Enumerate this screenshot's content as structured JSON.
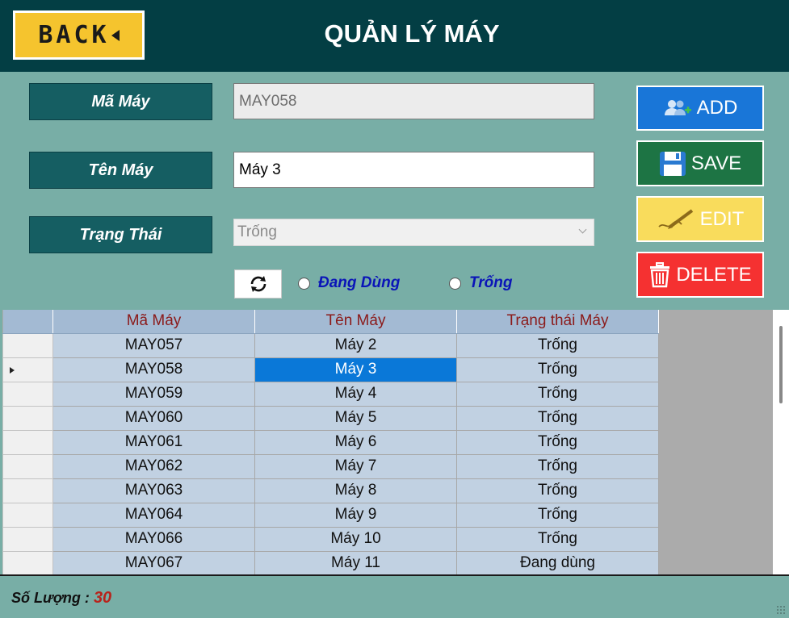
{
  "header": {
    "back_label": "BACK",
    "title": "QUẢN LÝ MÁY"
  },
  "form": {
    "ma_may_label": "Mã Máy",
    "ma_may_value": "MAY058",
    "ten_may_label": "Tên Máy",
    "ten_may_value": "Máy 3",
    "trang_thai_label": "Trạng Thái",
    "trang_thai_value": "Trống"
  },
  "filters": {
    "radio_dang_dung": "Đang Dùng",
    "radio_trong": "Trống"
  },
  "actions": {
    "add": "ADD",
    "save": "SAVE",
    "edit": "EDIT",
    "delete": "DELETE"
  },
  "table": {
    "columns": [
      "Mã Máy",
      "Tên Máy",
      "Trạng thái Máy"
    ],
    "selected_row": 1,
    "rows": [
      [
        "MAY057",
        "Máy 2",
        "Trống"
      ],
      [
        "MAY058",
        "Máy 3",
        "Trống"
      ],
      [
        "MAY059",
        "Máy 4",
        "Trống"
      ],
      [
        "MAY060",
        "Máy 5",
        "Trống"
      ],
      [
        "MAY061",
        "Máy 6",
        "Trống"
      ],
      [
        "MAY062",
        "Máy 7",
        "Trống"
      ],
      [
        "MAY063",
        "Máy 8",
        "Trống"
      ],
      [
        "MAY064",
        "Máy 9",
        "Trống"
      ],
      [
        "MAY066",
        "Máy 10",
        "Trống"
      ],
      [
        "MAY067",
        "Máy 11",
        "Đang dùng"
      ]
    ]
  },
  "footer": {
    "count_label": "Số Lượng :",
    "count_value": "30"
  },
  "colors": {
    "header_bg": "#033e44",
    "panel_bg": "#78aea6",
    "add": "#1976d8",
    "save": "#1d7444",
    "edit": "#f9dc5c",
    "delete": "#f53131",
    "selected_cell": "#0a78d8"
  },
  "icons": {
    "back": "back-arrow-icon",
    "add": "users-add-icon",
    "save": "floppy-disk-icon",
    "edit": "pencil-sign-icon",
    "delete": "trash-can-icon",
    "refresh": "refresh-icon"
  }
}
